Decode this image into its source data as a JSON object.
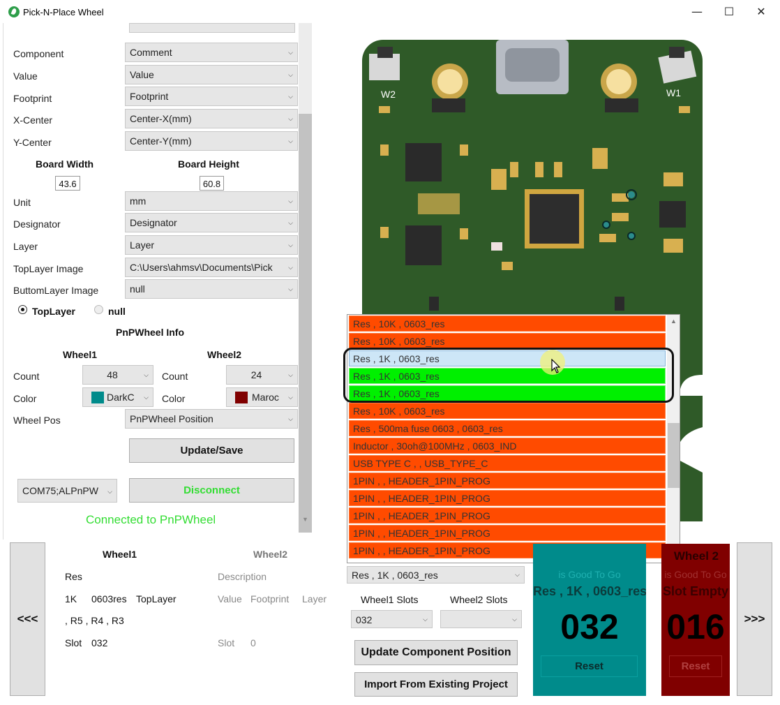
{
  "window": {
    "title": "Pick-N-Place Wheel",
    "minimize": "—",
    "maximize": "☐",
    "close": "✕"
  },
  "settings": {
    "component": {
      "label": "Component",
      "value": "Comment"
    },
    "value": {
      "label": "Value",
      "value": "Value"
    },
    "footprint": {
      "label": "Footprint",
      "value": "Footprint"
    },
    "xcenter": {
      "label": "X-Center",
      "value": "Center-X(mm)"
    },
    "ycenter": {
      "label": "Y-Center",
      "value": "Center-Y(mm)"
    },
    "board_width_label": "Board Width",
    "board_height_label": "Board Height",
    "board_width": "43.6",
    "board_height": "60.8",
    "unit": {
      "label": "Unit",
      "value": "mm"
    },
    "designator": {
      "label": "Designator",
      "value": "Designator"
    },
    "layer": {
      "label": "Layer",
      "value": "Layer"
    },
    "top_image": {
      "label": "TopLayer Image",
      "value": "C:\\Users\\ahmsv\\Documents\\Pick"
    },
    "bottom_image": {
      "label": "ButtomLayer Image",
      "value": "null"
    },
    "radio_top": "TopLayer",
    "radio_null": "null"
  },
  "pnp_info": {
    "heading": "PnPWheel Info",
    "wheel1": {
      "heading": "Wheel1",
      "count_label": "Count",
      "count": "48",
      "color_label": "Color",
      "color_name": "DarkC",
      "color": "#008b8b"
    },
    "wheel2": {
      "heading": "Wheel2",
      "count_label": "Count",
      "count": "24",
      "color_label": "Color",
      "color_name": "Maroc",
      "color": "#800000"
    },
    "wheel_pos_label": "Wheel Pos",
    "wheel_pos": "PnPWheel Position",
    "update_save": "Update/Save",
    "com_port": "COM75;ALPnPW",
    "disconnect": "Disconnect",
    "status": "Connected to PnPWheel"
  },
  "dropdown": {
    "items": [
      {
        "text": "Res , 10K , 0603_res",
        "state": "orange"
      },
      {
        "text": "Res , 10K , 0603_res",
        "state": "orange"
      },
      {
        "text": "Res , 1K , 0603_res",
        "state": "sel"
      },
      {
        "text": "Res , 1K , 0603_res",
        "state": "green"
      },
      {
        "text": "Res , 1K , 0603_res",
        "state": "green"
      },
      {
        "text": "Res , 10K , 0603_res",
        "state": "orange"
      },
      {
        "text": "Res , 500ma fuse 0603 , 0603_res",
        "state": "orange"
      },
      {
        "text": "Inductor , 30oh@100MHz , 0603_IND",
        "state": "orange"
      },
      {
        "text": "USB TYPE C , , USB_TYPE_C",
        "state": "orange"
      },
      {
        "text": "1PIN , , HEADER_1PIN_PROG",
        "state": "orange"
      },
      {
        "text": "1PIN , , HEADER_1PIN_PROG",
        "state": "orange"
      },
      {
        "text": "1PIN , , HEADER_1PIN_PROG",
        "state": "orange"
      },
      {
        "text": "1PIN , , HEADER_1PIN_PROG",
        "state": "orange"
      },
      {
        "text": "1PIN , , HEADER_1PIN_PROG",
        "state": "orange"
      }
    ],
    "selected": "Res , 1K , 0603_res"
  },
  "board": {
    "label_w1": "W1",
    "label_w2": "W2"
  },
  "bottom": {
    "prev": "<<<",
    "next": ">>>",
    "wheel1_heading": "Wheel1",
    "wheel1_line1": "Res",
    "wheel1_value": "1K",
    "wheel1_footprint": "0603res",
    "wheel1_layer": "TopLayer",
    "wheel1_designators": ", R5 , R4 , R3",
    "wheel1_slot_label": "Slot",
    "wheel1_slot": "032",
    "wheel2_heading": "Wheel2",
    "wheel2_desc": "Description",
    "wheel2_value": "Value",
    "wheel2_footprint": "Footprint",
    "wheel2_layer": "Layer",
    "wheel2_slot_label": "Slot",
    "wheel2_slot": "0",
    "wheel1_slots_label": "Wheel1 Slots",
    "wheel2_slots_label": "Wheel2 Slots",
    "wheel1_slot_select": "032",
    "wheel2_slot_select": "",
    "update_position": "Update Component Position",
    "import_existing": "Import From Existing Project",
    "card1": {
      "status": "is Good To Go",
      "component": "Res , 1K , 0603_res",
      "number": "032",
      "reset": "Reset"
    },
    "card2": {
      "heading": "Wheel 2",
      "status": "is Good To Go",
      "component": "Slot Empty",
      "number": "016",
      "reset": "Reset"
    }
  }
}
